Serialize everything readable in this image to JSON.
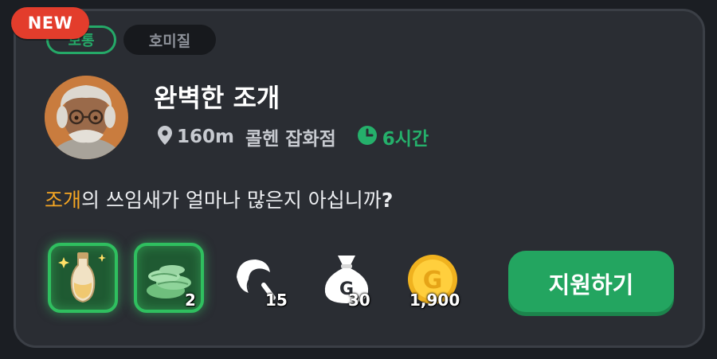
{
  "badges": {
    "new": "NEW",
    "grade": "보통",
    "category": "호미질"
  },
  "quest": {
    "title": "완벽한 조개",
    "distance": "160m",
    "shop": "콜헨 잡화점",
    "duration": "6시간",
    "question_highlight": "조개",
    "question_text": "의 쓰임새가 얼마나 많은지 아십니까",
    "question_mark": "?"
  },
  "rewards": {
    "potion_icon": "potion-icon",
    "stones_count": "2",
    "feather_count": "15",
    "money_bag_count": "30",
    "gold_count": "1,900"
  },
  "button": {
    "apply_label": "지원하기"
  },
  "colors": {
    "accent_green": "#25a968",
    "new_red": "#e33d2c",
    "highlight_orange": "#f5a623"
  }
}
